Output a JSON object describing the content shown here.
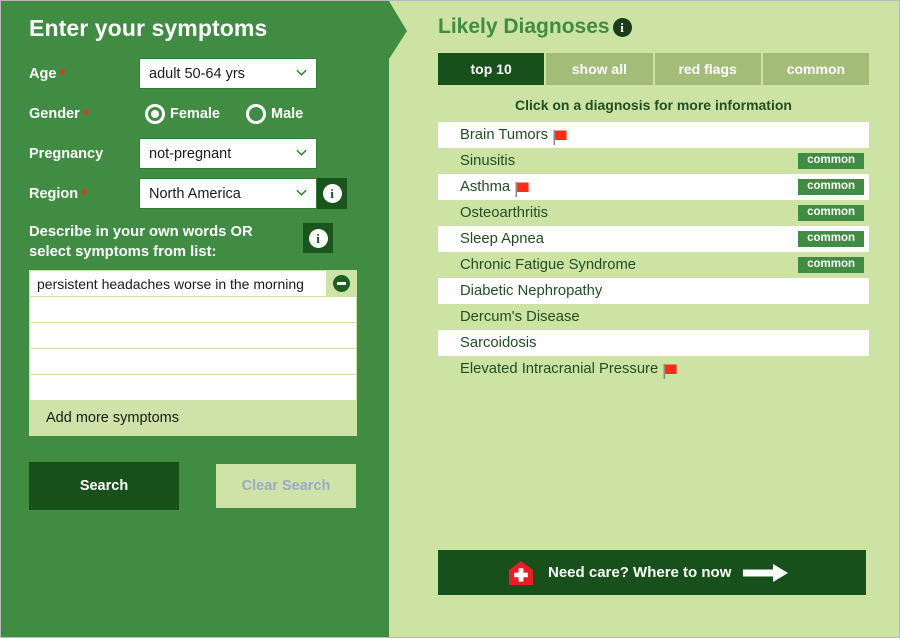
{
  "left": {
    "title": "Enter your symptoms",
    "fields": [
      {
        "label": "Age",
        "required": true,
        "type": "select",
        "value": "adult 50-64 yrs",
        "info": false
      },
      {
        "label": "Gender",
        "required": true,
        "type": "radio",
        "value": "Female",
        "info": false
      },
      {
        "label": "Pregnancy",
        "required": false,
        "type": "select",
        "value": "not-pregnant",
        "info": false
      },
      {
        "label": "Region",
        "required": true,
        "type": "select",
        "value": "North America",
        "info": true
      }
    ],
    "gender_options": [
      {
        "label": "Female",
        "selected": true
      },
      {
        "label": "Male",
        "selected": false
      }
    ],
    "describe_line1": "Describe in your own words OR",
    "describe_line2": "select symptoms from list:",
    "describe_info_icon": "info-icon",
    "symptom_rows": [
      {
        "value": "persistent headaches worse in the morning",
        "placeholder": "",
        "removable": true
      },
      {
        "value": "",
        "placeholder": "",
        "removable": false
      },
      {
        "value": "",
        "placeholder": "",
        "removable": false
      },
      {
        "value": "",
        "placeholder": "",
        "removable": false
      },
      {
        "value": "",
        "placeholder": "",
        "removable": false
      }
    ],
    "add_more_label": "Add more symptoms",
    "search_label": "Search",
    "clear_label": "Clear Search",
    "required_marker": "*"
  },
  "right": {
    "title": "Likely Diagnoses",
    "title_info_icon": "info-icon",
    "tabs": [
      {
        "label": "top 10",
        "active": true
      },
      {
        "label": "show all",
        "active": false
      },
      {
        "label": "red flags",
        "active": false
      },
      {
        "label": "common",
        "active": false
      }
    ],
    "hint": "Click on a diagnosis for more information",
    "diagnoses": [
      {
        "name": "Brain Tumors",
        "red_flag": true,
        "common": false
      },
      {
        "name": "Sinusitis",
        "red_flag": false,
        "common": true
      },
      {
        "name": "Asthma",
        "red_flag": true,
        "common": true
      },
      {
        "name": "Osteoarthritis",
        "red_flag": false,
        "common": true
      },
      {
        "name": "Sleep Apnea",
        "red_flag": false,
        "common": true
      },
      {
        "name": "Chronic Fatigue Syndrome",
        "red_flag": false,
        "common": true
      },
      {
        "name": "Diabetic Nephropathy",
        "red_flag": false,
        "common": false
      },
      {
        "name": "Dercum's Disease",
        "red_flag": false,
        "common": false
      },
      {
        "name": "Sarcoidosis",
        "red_flag": false,
        "common": false
      },
      {
        "name": "Elevated Intracranial Pressure",
        "red_flag": true,
        "common": false
      }
    ],
    "common_badge_label": "common",
    "need_care_text": "Need care?  Where to now",
    "need_care_icon": "clinic-cross-icon",
    "need_care_arrow_icon": "arrow-right-icon"
  },
  "colors": {
    "panel_green": "#3f8c42",
    "dark_green": "#17501a",
    "light_green_bg": "#cde3a3",
    "pale_green": "#cfe3a8",
    "tab_inactive": "#a3bd78",
    "red_flag": "#ff2b15",
    "text_green": "#1f4f23",
    "clear_text": "#9aabc4"
  }
}
